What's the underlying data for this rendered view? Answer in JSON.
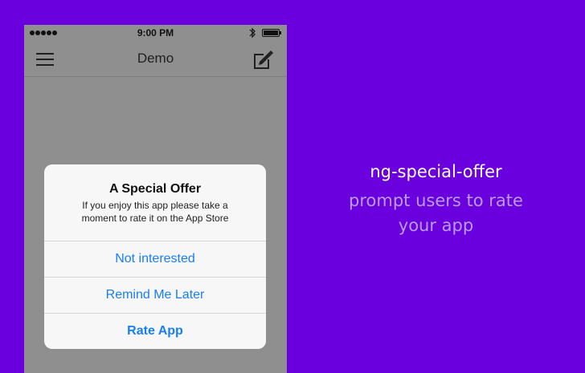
{
  "phone": {
    "status_bar": {
      "time": "9:00 PM"
    },
    "nav_bar": {
      "title": "Demo"
    },
    "modal": {
      "title": "A Special Offer",
      "message": "If you enjoy this app please take a moment to rate it on the App Store",
      "actions": [
        "Not interested",
        "Remind Me Later",
        "Rate App"
      ]
    }
  },
  "promo": {
    "title": "ng-special-offer",
    "subtitle": "prompt users to rate your app"
  },
  "icons": {
    "signal": "signal-dots-icon",
    "bluetooth": "bluetooth-icon",
    "battery": "battery-icon",
    "menu": "hamburger-menu-icon",
    "compose": "compose-icon"
  },
  "colors": {
    "background": "#6a00dd",
    "phone_overlay": "#8f8f8f",
    "modal_background": "#f7f7f7",
    "accent": "#167efb",
    "promo_title": "#ffffff",
    "promo_subtitle": "#b99cf1"
  }
}
